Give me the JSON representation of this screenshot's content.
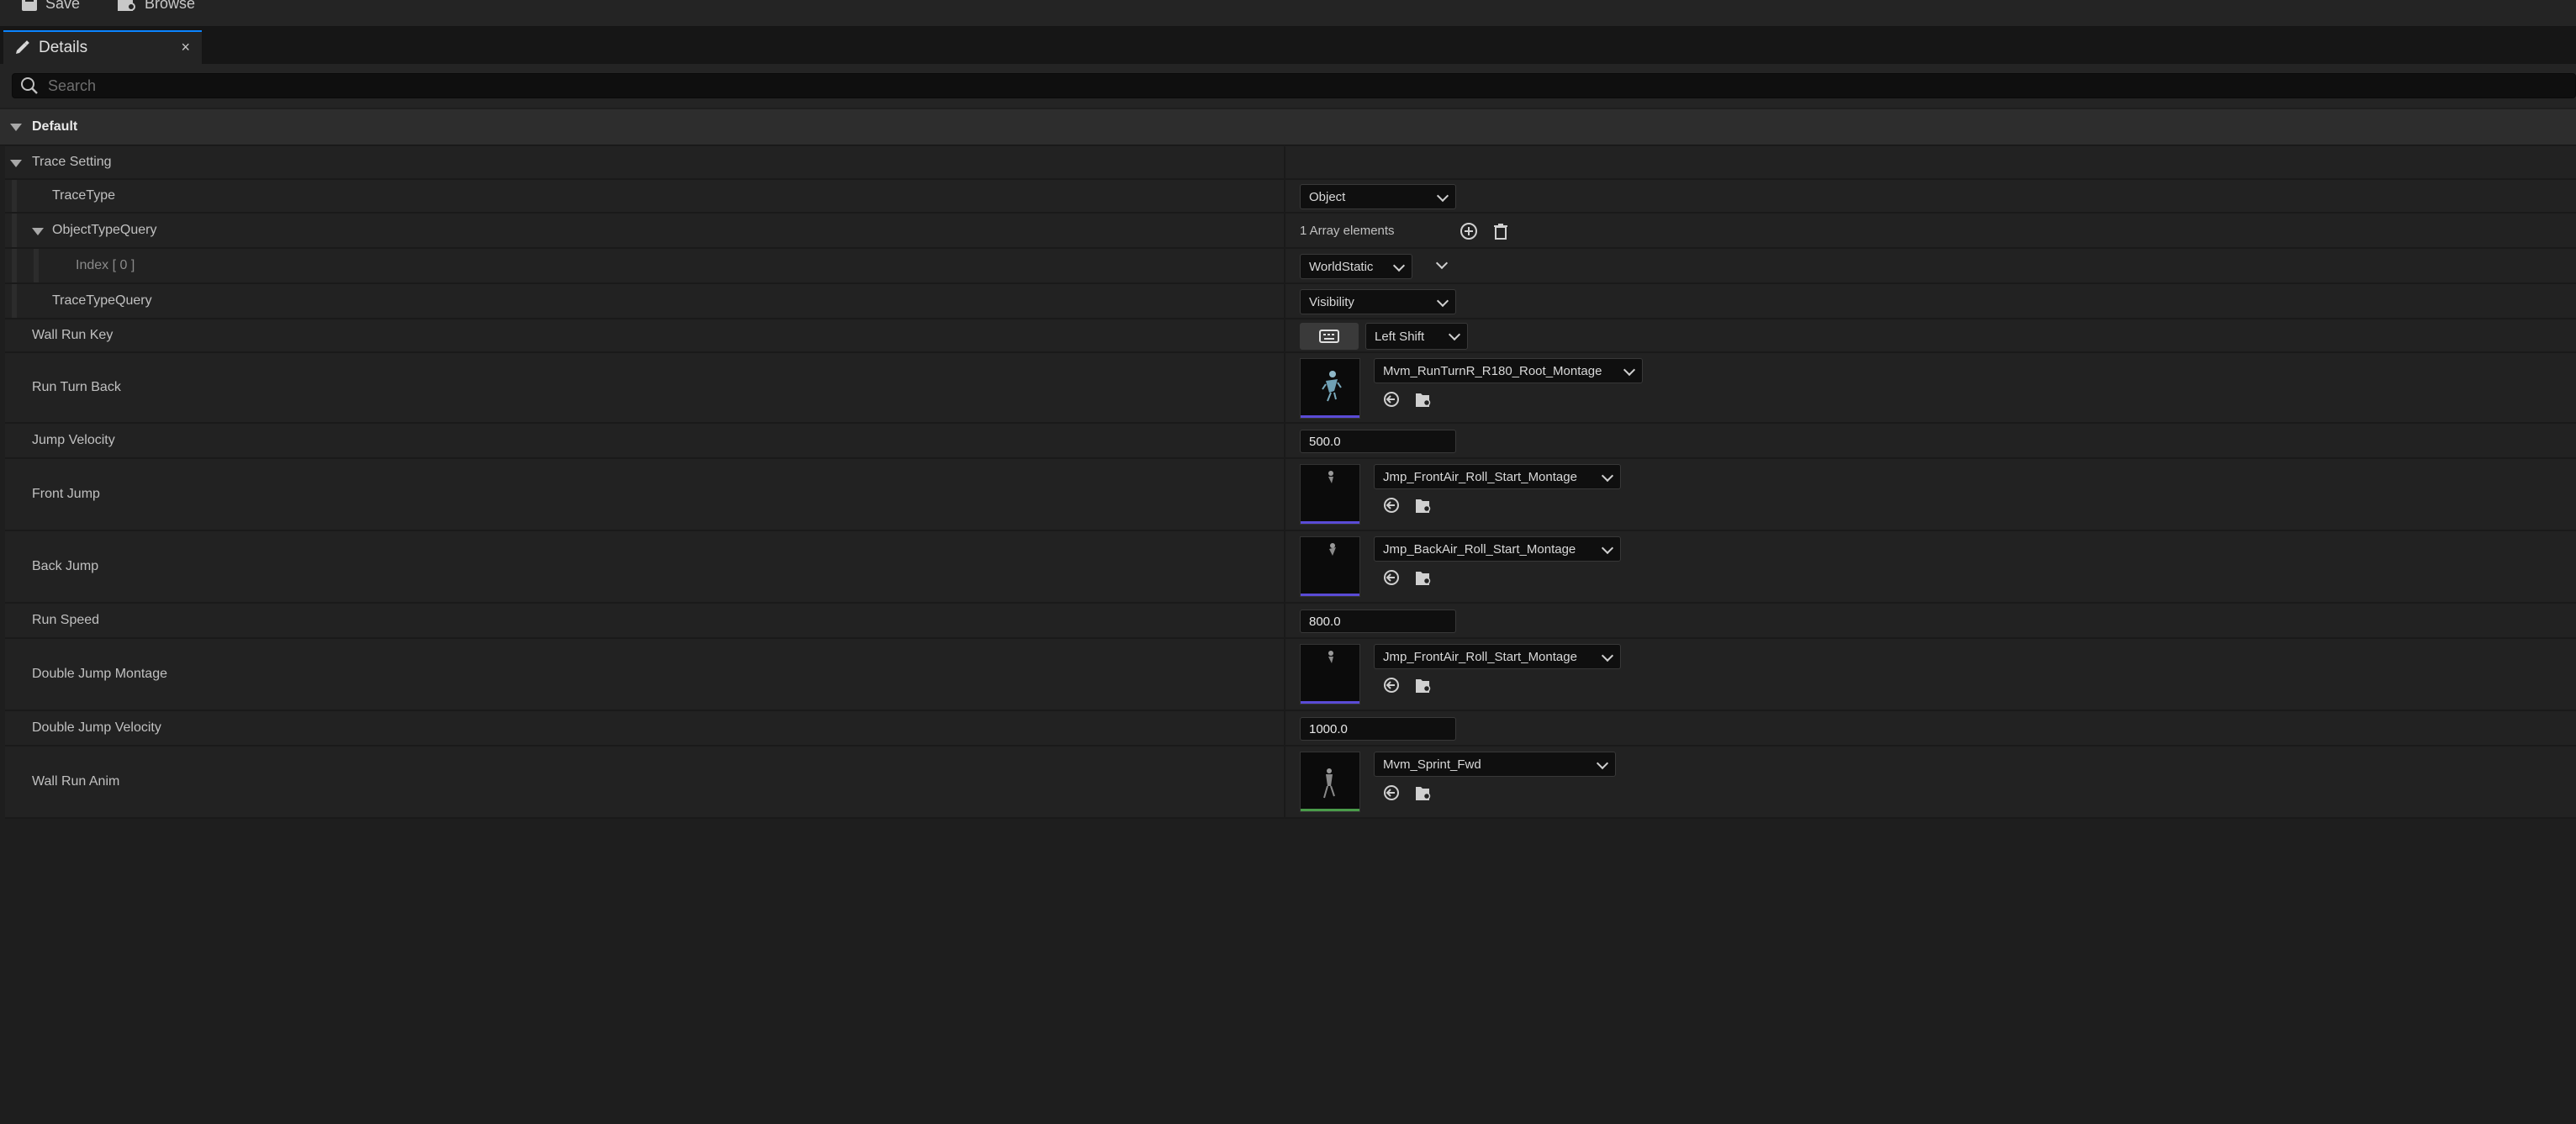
{
  "toolbar": {
    "save_label": "Save",
    "browse_label": "Browse"
  },
  "tab": {
    "label": "Details",
    "close": "×"
  },
  "search": {
    "placeholder": "Search"
  },
  "category": {
    "label": "Default"
  },
  "trace_setting": {
    "label": "Trace Setting",
    "trace_type": {
      "label": "TraceType",
      "value": "Object"
    },
    "object_type_query": {
      "label": "ObjectTypeQuery",
      "summary": "1 Array elements"
    },
    "index0": {
      "label": "Index [ 0 ]",
      "value": "WorldStatic"
    },
    "trace_type_query": {
      "label": "TraceTypeQuery",
      "value": "Visibility"
    }
  },
  "properties": {
    "wall_run_key": {
      "label": "Wall Run Key",
      "value": "Left Shift"
    },
    "run_turn_back": {
      "label": "Run Turn Back",
      "asset": "Mvm_RunTurnR_R180_Root_Montage"
    },
    "jump_velocity": {
      "label": "Jump Velocity",
      "value": "500.0"
    },
    "front_jump": {
      "label": "Front Jump",
      "asset": "Jmp_FrontAir_Roll_Start_Montage"
    },
    "back_jump": {
      "label": "Back Jump",
      "asset": "Jmp_BackAir_Roll_Start_Montage"
    },
    "run_speed": {
      "label": "Run Speed",
      "value": "800.0"
    },
    "double_jump_montage": {
      "label": "Double Jump Montage",
      "asset": "Jmp_FrontAir_Roll_Start_Montage"
    },
    "double_jump_velocity": {
      "label": "Double Jump Velocity",
      "value": "1000.0"
    },
    "wall_run_anim": {
      "label": "Wall Run Anim",
      "asset": "Mvm_Sprint_Fwd"
    }
  },
  "colors": {
    "accent": "#0a84ff",
    "montage_underline": "#5a4bd6",
    "anim_underline": "#4a9c4a"
  }
}
